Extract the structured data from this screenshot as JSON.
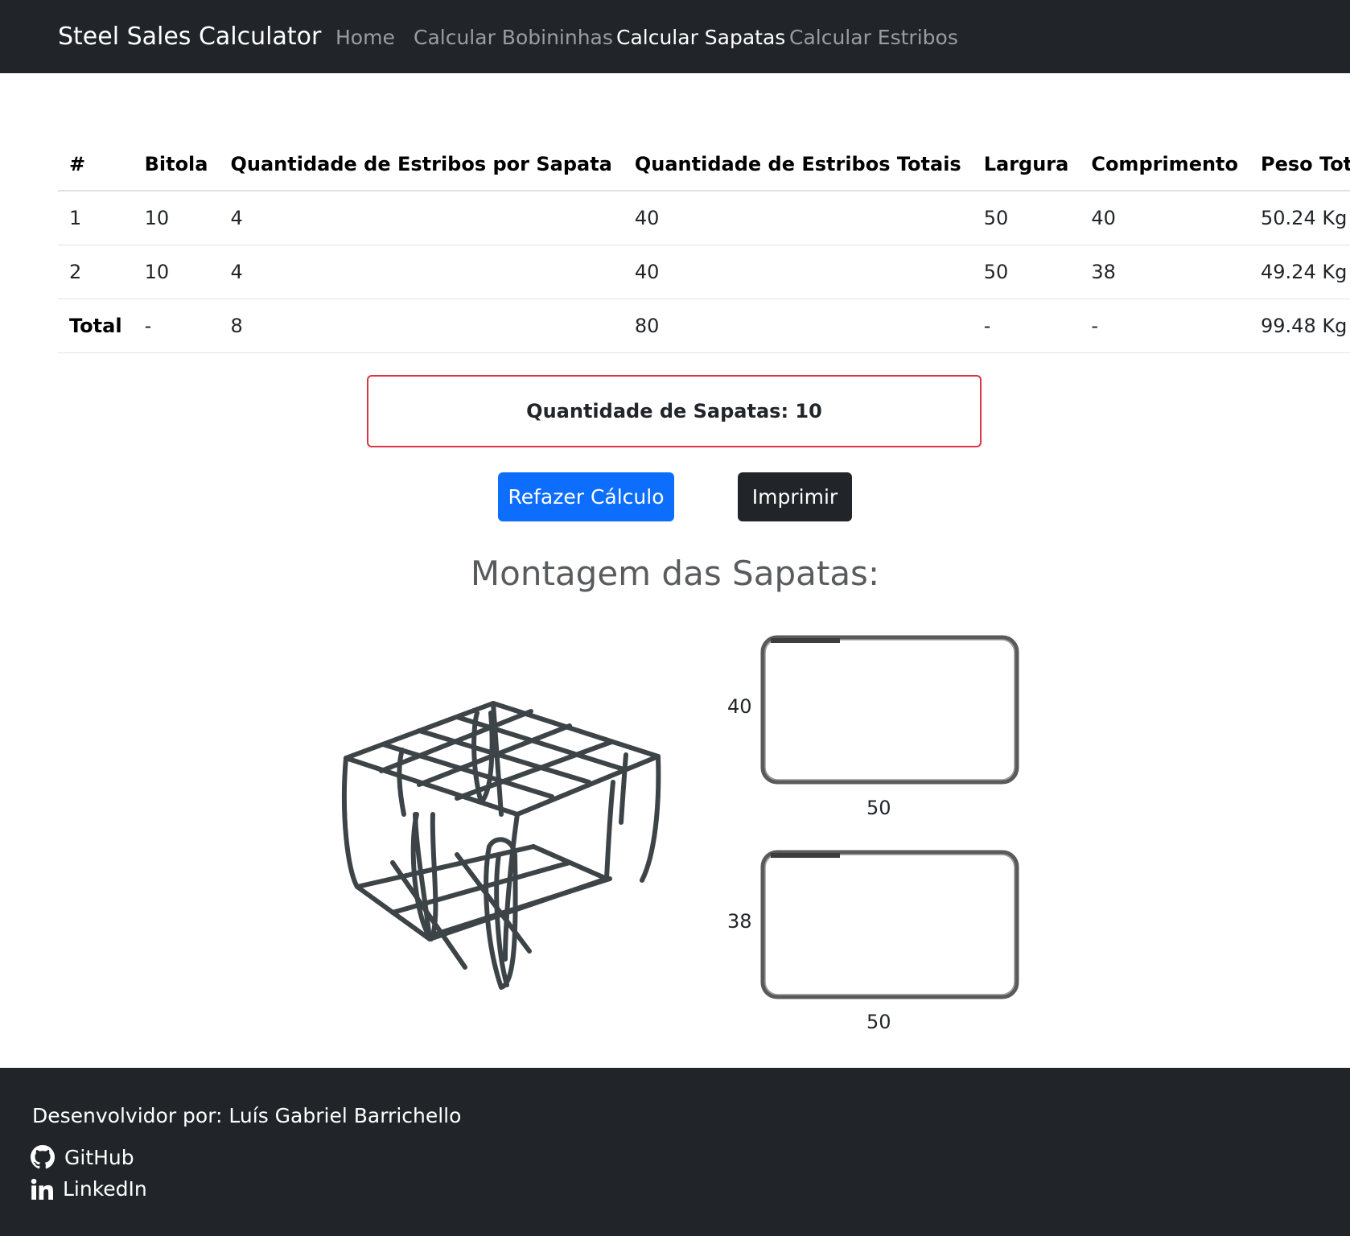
{
  "navbar": {
    "brand": "Steel Sales Calculator",
    "links": [
      {
        "label": "Home",
        "active": false
      },
      {
        "label": "Calcular Bobininhas",
        "active": false
      },
      {
        "label": "Calcular Sapatas",
        "active": true
      },
      {
        "label": "Calcular Estribos",
        "active": false
      }
    ]
  },
  "table": {
    "headers": [
      "#",
      "Bitola",
      "Quantidade de Estribos por Sapata",
      "Quantidade de Estribos Totais",
      "Largura",
      "Comprimento",
      "Peso Total"
    ],
    "rows": [
      [
        "1",
        "10",
        "4",
        "40",
        "50",
        "40",
        "50.24 Kg"
      ],
      [
        "2",
        "10",
        "4",
        "40",
        "50",
        "38",
        "49.24 Kg"
      ]
    ],
    "total_row": [
      "Total",
      "-",
      "8",
      "80",
      "-",
      "-",
      "99.48 Kg"
    ]
  },
  "quantity_box": {
    "text": "Quantidade de Sapatas: 10"
  },
  "buttons": {
    "recalc": "Refazer Cálculo",
    "print": "Imprimir"
  },
  "assembly": {
    "heading": "Montagem das Sapatas:",
    "stirrups": [
      {
        "height": "40",
        "width": "50"
      },
      {
        "height": "38",
        "width": "50"
      }
    ]
  },
  "footer": {
    "developer": "Desenvolvidor por: Luís Gabriel Barrichello",
    "github": "GitHub",
    "linkedin": "LinkedIn"
  },
  "colors": {
    "navbar_bg": "#212529",
    "primary": "#0d6efd",
    "danger_border": "#dc3545"
  }
}
